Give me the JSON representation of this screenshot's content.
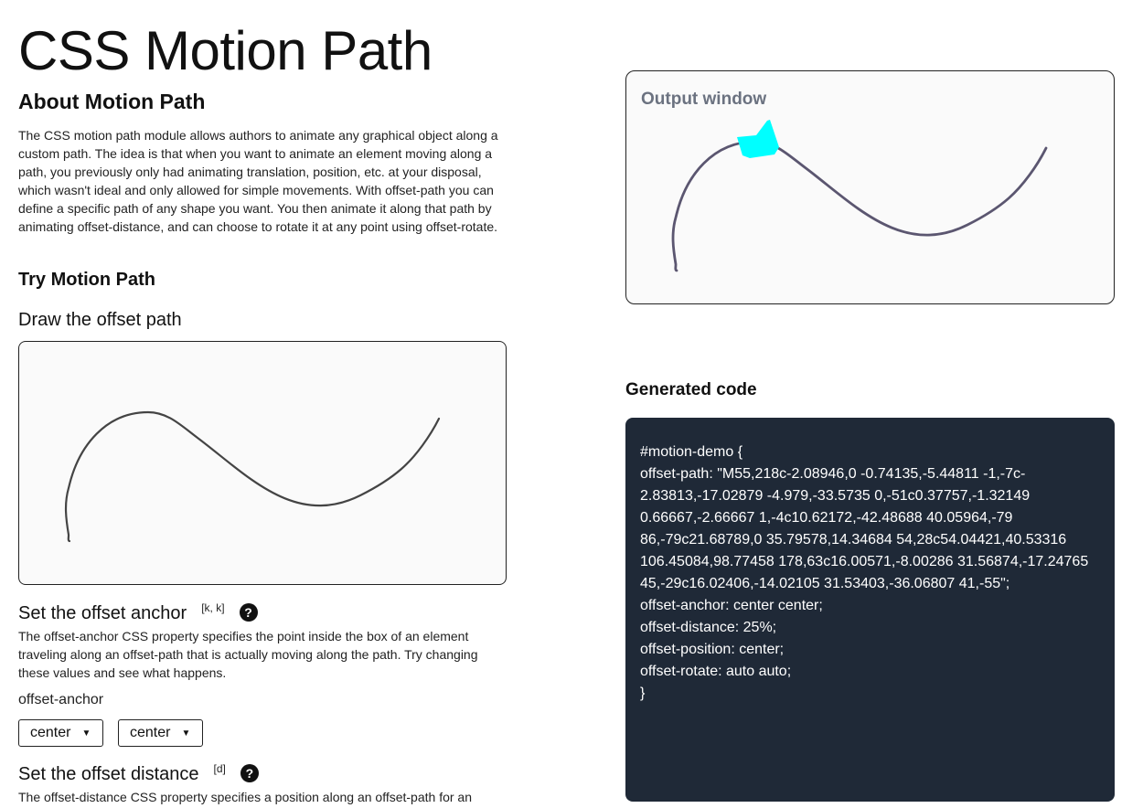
{
  "title": "CSS Motion Path",
  "about": {
    "heading": "About Motion Path",
    "text": "The CSS motion path module allows authors to animate any graphical object along a custom path. The idea is that when you want to animate an element moving along a path, you previously only had animating translation, position, etc. at your disposal, which wasn't ideal and only allowed for simple movements. With offset-path you can define a specific path of any shape you want. You then animate it along that path by animating offset-distance, and can choose to rotate it at any point using offset-rotate."
  },
  "try": {
    "heading": "Try Motion Path",
    "draw_heading": "Draw the offset path"
  },
  "anchor": {
    "heading": "Set the offset anchor",
    "shortcut": "[k, k]",
    "help": "?",
    "text": "The offset-anchor CSS property specifies the point inside the box of an element traveling along an offset-path that is actually moving along the path. Try changing these values and see what happens.",
    "label": "offset-anchor",
    "x_value": "center",
    "y_value": "center"
  },
  "distance": {
    "heading": "Set the offset distance",
    "shortcut": "[d]",
    "help": "?",
    "text": "The offset-distance CSS property specifies a position along an offset-path for an"
  },
  "output": {
    "label": "Output window",
    "shape_color": "#00ffff",
    "path_color": "#5b5670"
  },
  "code": {
    "heading": "Generated code",
    "lines": [
      "#motion-demo {",
      "offset-path: \"M55,218c-2.08946,0 -0.74135,-5.44811 -1,-7c-2.83813,-17.02879 -4.979,-33.5735 0,-51c0.37757,-1.32149 0.66667,-2.66667 1,-4c10.62172,-42.48688 40.05964,-79 86,-79c21.68789,0 35.79578,14.34684 54,28c54.04421,40.53316 106.45084,98.77458 178,63c16.00571,-8.00286 31.56874,-17.24765 45,-29c16.02406,-14.02105 31.53403,-36.06807 41,-55\";",
      "offset-anchor: center center;",
      "offset-distance: 25%;",
      "offset-position: center;",
      "offset-rotate: auto auto;",
      "}"
    ]
  }
}
